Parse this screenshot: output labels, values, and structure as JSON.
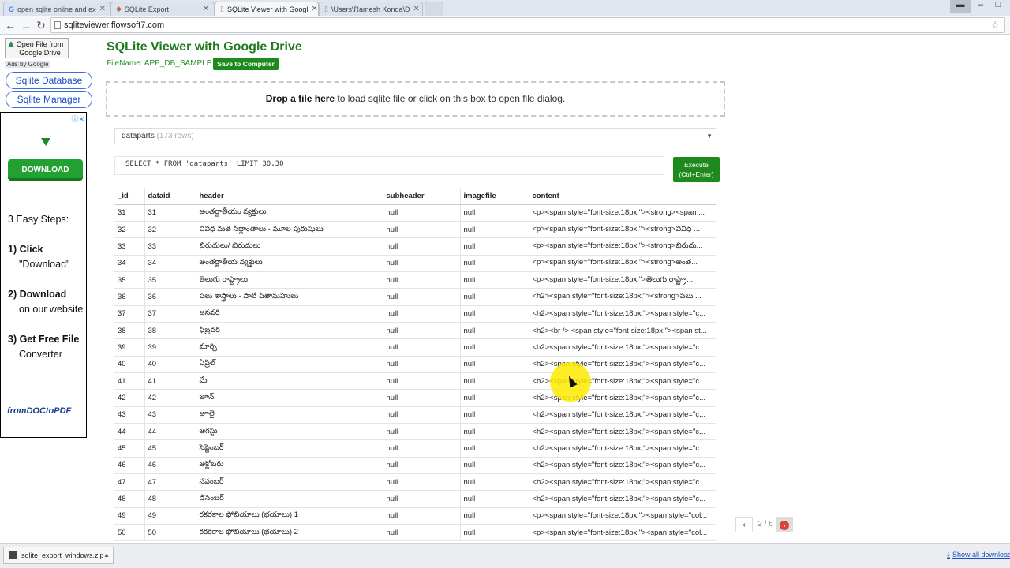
{
  "browser": {
    "tabs": [
      {
        "label": "open sqlite online and ex"
      },
      {
        "label": "SQLite Export"
      },
      {
        "label": "SQLite Viewer with Googl"
      },
      {
        "label": "\\Users\\Ramesh Konda\\D"
      }
    ],
    "url": "sqliteviewer.flowsoft7.com"
  },
  "sidebar": {
    "open_drive": "Open File from Google Drive",
    "ads_by": "Ads by Google",
    "sqlite_database": "Sqlite Database",
    "sqlite_manager": "Sqlite Manager",
    "ad": {
      "download": "DOWNLOAD",
      "steps_title": "3 Easy Steps:",
      "step1_a": "1) Click",
      "step1_b": "\"Download\"",
      "step2_a": "2) Download",
      "step2_b": "on our website",
      "step3_a": "3) Get Free File",
      "step3_b": "Converter",
      "brand": "fromDOCtoPDF"
    }
  },
  "main": {
    "title": "SQLite Viewer with Google Drive",
    "filename": "FileName: APP_DB_SAMPLE",
    "save_button": "Save to Computer",
    "drop_bold": "Drop a file here",
    "drop_rest": " to load sqlite file or click on this box to open file dialog.",
    "table_select": "dataparts",
    "table_rows": "(173 rows)",
    "query": "SELECT * FROM 'dataparts' LIMIT 30,30",
    "execute_label": "Execute",
    "execute_shortcut": "(Ctrl+Enter)",
    "columns": [
      "_id",
      "dataid",
      "header",
      "subheader",
      "imagefile",
      "content"
    ],
    "rows": [
      [
        "31",
        "31",
        "అంతర్జాతీయం వ్యక్తులు",
        "null",
        "null",
        "<p><span style=\"font-size:18px;\"><strong><span ..."
      ],
      [
        "32",
        "32",
        "వివిధ మత సిద్ధాంతాలు - మూల పురుషులు",
        "null",
        "null",
        "<p><span style=\"font-size:18px;\"><strong>వివిధ ..."
      ],
      [
        "33",
        "33",
        "బిరుదులు/ బిరుదులు",
        "null",
        "null",
        "<p><span style=\"font-size:18px;\"><strong>బిరుదు..."
      ],
      [
        "34",
        "34",
        "అంతర్జాతీయ వ్యక్తులు",
        "null",
        "null",
        "<p><span style=\"font-size:18px;\"><strong>అంత..."
      ],
      [
        "35",
        "35",
        "తెలుగు రాష్ట్రాలు",
        "null",
        "null",
        "<p><span style=\"font-size:18px;\">తెలుగు రాష్ట్రా..."
      ],
      [
        "36",
        "36",
        "పలు శాస్త్రాలు - పాటి పితామహులు",
        "null",
        "null",
        "<h2><span style=\"font-size:18px;\"><strong>పలు ..."
      ],
      [
        "37",
        "37",
        "జనవరి",
        "null",
        "null",
        "<h2><span style=\"font-size:18px;\"><span style=\"c..."
      ],
      [
        "38",
        "38",
        "ఫిబ్రవరి",
        "null",
        "null",
        "<h2><br /> <span style=\"font-size:18px;\"><span st..."
      ],
      [
        "39",
        "39",
        "మార్చి",
        "null",
        "null",
        "<h2><span style=\"font-size:18px;\"><span style=\"c..."
      ],
      [
        "40",
        "40",
        "ఏప్రిల్",
        "null",
        "null",
        "<h2><span style=\"font-size:18px;\"><span style=\"c..."
      ],
      [
        "41",
        "41",
        "మే",
        "null",
        "null",
        "<h2><span style=\"font-size:18px;\"><span style=\"c..."
      ],
      [
        "42",
        "42",
        "జూన్",
        "null",
        "null",
        "<h2><span style=\"font-size:18px;\"><span style=\"c..."
      ],
      [
        "43",
        "43",
        "జూలై",
        "null",
        "null",
        "<h2><span style=\"font-size:18px;\"><span style=\"c..."
      ],
      [
        "44",
        "44",
        "ఆగస్టు",
        "null",
        "null",
        "<h2><span style=\"font-size:18px;\"><span style=\"c..."
      ],
      [
        "45",
        "45",
        "సెప్టెంబర్",
        "null",
        "null",
        "<h2><span style=\"font-size:18px;\"><span style=\"c..."
      ],
      [
        "46",
        "46",
        "అక్టోబరు",
        "null",
        "null",
        "<h2><span style=\"font-size:18px;\"><span style=\"c..."
      ],
      [
        "47",
        "47",
        "నవంబర్",
        "null",
        "null",
        "<h2><span style=\"font-size:18px;\"><span style=\"c..."
      ],
      [
        "48",
        "48",
        "డిసెంబర్",
        "null",
        "null",
        "<h2><span style=\"font-size:18px;\"><span style=\"c..."
      ],
      [
        "49",
        "49",
        "రకరకాల ఫోబియాలు (భయాలు) 1",
        "null",
        "null",
        "<p><span style=\"font-size:18px;\"><span style=\"col..."
      ],
      [
        "50",
        "50",
        "రకరకాల ఫోబియాలు (భయాలు) 2",
        "null",
        "null",
        "<p><span style=\"font-size:18px;\"><span style=\"col..."
      ]
    ],
    "pager": {
      "label": "2 / 6",
      "prev": "‹",
      "next": "›"
    }
  },
  "downloads": {
    "file": "sqlite_export_windows.zip",
    "show_all": "Show all downloads"
  },
  "colors": {
    "brand_green": "#1e8a1e",
    "link_blue": "#1a4fbf"
  }
}
